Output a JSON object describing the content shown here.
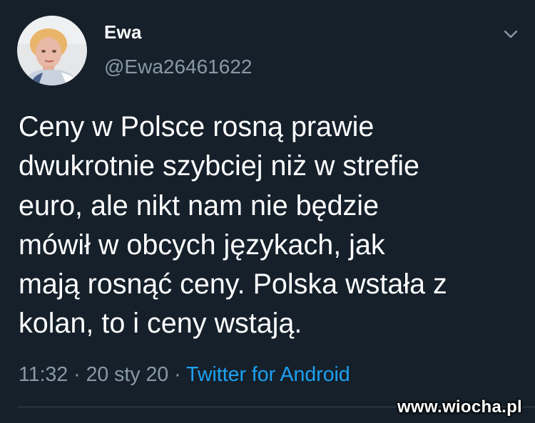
{
  "tweet": {
    "author": {
      "display_name": "Ewa",
      "handle": "@Ewa26461622"
    },
    "menu_icon": "chevron-down-icon",
    "text": "Ceny w Polsce rosną prawie\ndwukrotnie szybciej niż w strefie\neuro, ale nikt nam nie będzie\nmówił w obcych językach, jak\nmają rosnąć ceny. Polska wstała z\nkolan, to i ceny wstają.",
    "time": "11:32",
    "separator": "·",
    "date": "20 sty 20",
    "source": "Twitter for Android"
  },
  "watermark": "www.wiocha.pl",
  "colors": {
    "background": "#15202b",
    "primary_text": "#ffffff",
    "secondary_text": "#8899a6",
    "link": "#1da1f2",
    "divider": "#38444d"
  }
}
